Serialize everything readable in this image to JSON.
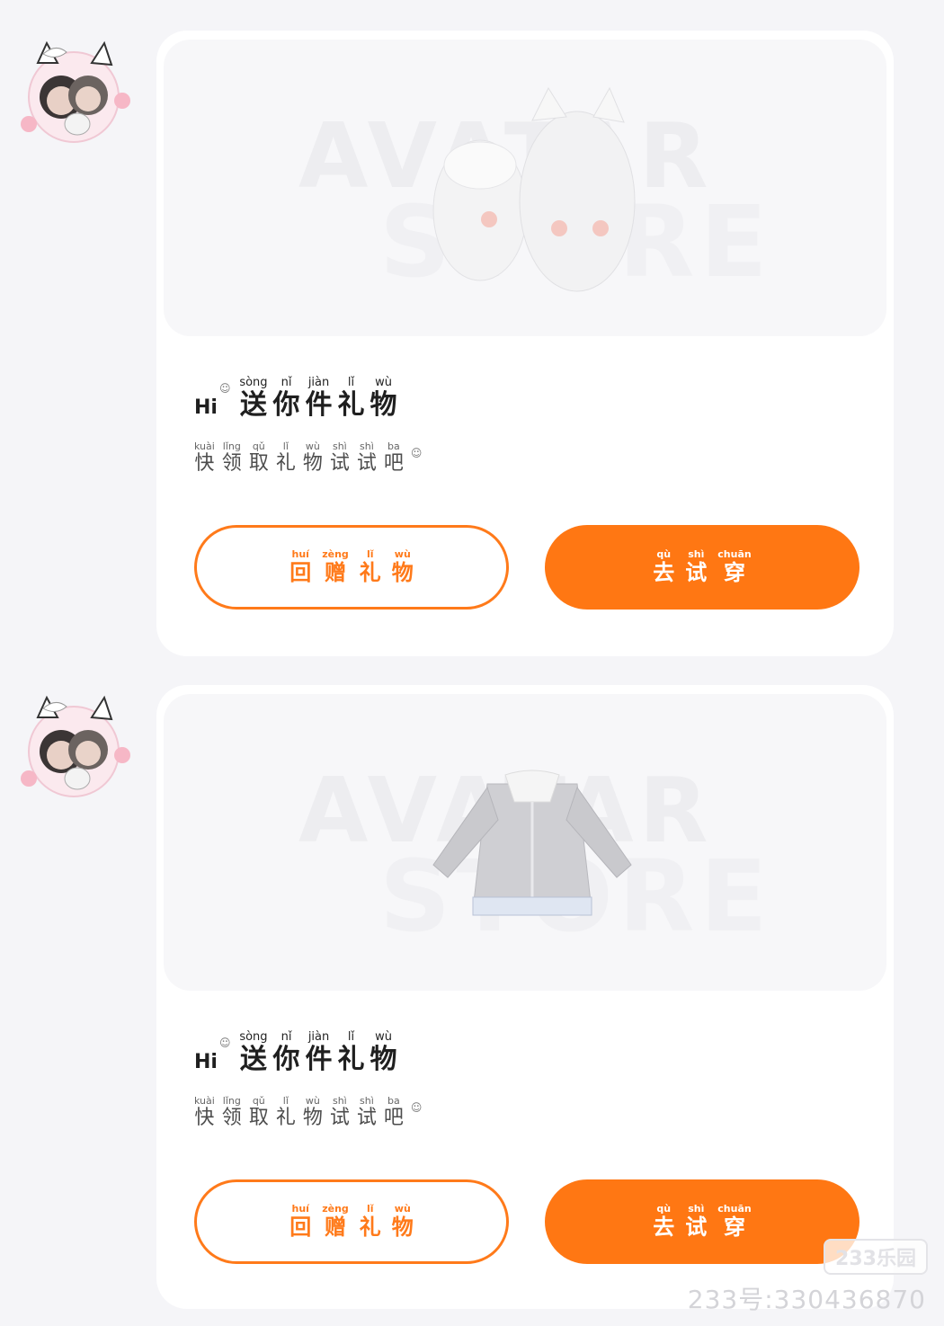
{
  "messages": [
    {
      "watermark_top": "AVATAR",
      "watermark_bottom": "STORE",
      "item_icon": "white-kitten-hoodie-outfit",
      "hi": "Hi",
      "title": [
        {
          "char": "送",
          "pinyin": "sòng"
        },
        {
          "char": "你",
          "pinyin": "nǐ"
        },
        {
          "char": "件",
          "pinyin": "jiàn"
        },
        {
          "char": "礼",
          "pinyin": "lǐ"
        },
        {
          "char": "物",
          "pinyin": "wù"
        }
      ],
      "subtitle": [
        {
          "char": "快",
          "pinyin": "kuài"
        },
        {
          "char": "领",
          "pinyin": "lǐng"
        },
        {
          "char": "取",
          "pinyin": "qǔ"
        },
        {
          "char": "礼",
          "pinyin": "lǐ"
        },
        {
          "char": "物",
          "pinyin": "wù"
        },
        {
          "char": "试",
          "pinyin": "shì"
        },
        {
          "char": "试",
          "pinyin": "shì"
        },
        {
          "char": "吧",
          "pinyin": "ba"
        }
      ],
      "return_gift": [
        {
          "char": "回",
          "pinyin": "huí"
        },
        {
          "char": "赠",
          "pinyin": "zèng"
        },
        {
          "char": "礼",
          "pinyin": "lǐ"
        },
        {
          "char": "物",
          "pinyin": "wù"
        }
      ],
      "try_on": [
        {
          "char": "去",
          "pinyin": "qù"
        },
        {
          "char": "试",
          "pinyin": "shì"
        },
        {
          "char": "穿",
          "pinyin": "chuān"
        }
      ]
    },
    {
      "watermark_top": "AVATAR",
      "watermark_bottom": "STORE",
      "item_icon": "grey-cardigan-jacket",
      "hi": "Hi",
      "title": [
        {
          "char": "送",
          "pinyin": "sòng"
        },
        {
          "char": "你",
          "pinyin": "nǐ"
        },
        {
          "char": "件",
          "pinyin": "jiàn"
        },
        {
          "char": "礼",
          "pinyin": "lǐ"
        },
        {
          "char": "物",
          "pinyin": "wù"
        }
      ],
      "subtitle": [
        {
          "char": "快",
          "pinyin": "kuài"
        },
        {
          "char": "领",
          "pinyin": "lǐng"
        },
        {
          "char": "取",
          "pinyin": "qǔ"
        },
        {
          "char": "礼",
          "pinyin": "lǐ"
        },
        {
          "char": "物",
          "pinyin": "wù"
        },
        {
          "char": "试",
          "pinyin": "shì"
        },
        {
          "char": "试",
          "pinyin": "shì"
        },
        {
          "char": "吧",
          "pinyin": "ba"
        }
      ],
      "return_gift": [
        {
          "char": "回",
          "pinyin": "huí"
        },
        {
          "char": "赠",
          "pinyin": "zèng"
        },
        {
          "char": "礼",
          "pinyin": "lǐ"
        },
        {
          "char": "物",
          "pinyin": "wù"
        }
      ],
      "try_on": [
        {
          "char": "去",
          "pinyin": "qù"
        },
        {
          "char": "试",
          "pinyin": "shì"
        },
        {
          "char": "穿",
          "pinyin": "chuān"
        }
      ]
    }
  ],
  "footer": {
    "logo": "233乐园",
    "id_text": "233号:330436870"
  },
  "colors": {
    "accent": "#ff7713",
    "background": "#f5f5f8",
    "card": "#ffffff"
  }
}
